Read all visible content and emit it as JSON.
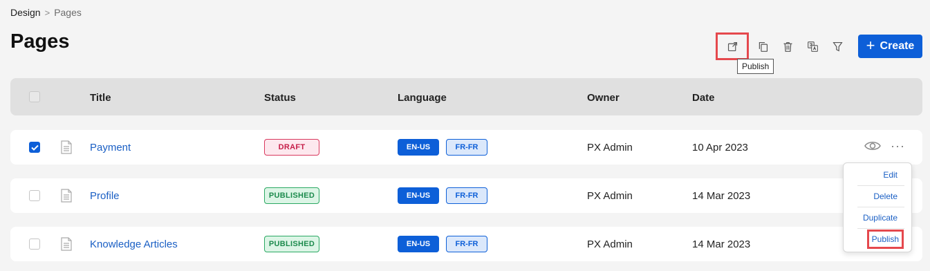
{
  "breadcrumb": {
    "home": "Design",
    "separator": ">",
    "current": "Pages"
  },
  "page_title": "Pages",
  "toolbar": {
    "publish_icon": "external-link-icon",
    "duplicate_icon": "copy-icon",
    "delete_icon": "trash-icon",
    "translate_icon": "translate-icon",
    "filter_icon": "filter-icon",
    "tooltip": "Publish",
    "create_label": "Create",
    "create_icon": "+"
  },
  "table": {
    "columns": {
      "title": "Title",
      "status": "Status",
      "language": "Language",
      "owner": "Owner",
      "date": "Date"
    },
    "rows": [
      {
        "checked": true,
        "title": "Payment",
        "status": "DRAFT",
        "lang_primary": "EN-US",
        "lang_secondary": "FR-FR",
        "owner": "PX Admin",
        "date": "10 Apr 2023"
      },
      {
        "checked": false,
        "title": "Profile",
        "status": "PUBLISHED",
        "lang_primary": "EN-US",
        "lang_secondary": "FR-FR",
        "owner": "PX Admin",
        "date": "14 Mar 2023"
      },
      {
        "checked": false,
        "title": "Knowledge Articles",
        "status": "PUBLISHED",
        "lang_primary": "EN-US",
        "lang_secondary": "FR-FR",
        "owner": "PX Admin",
        "date": "14 Mar 2023"
      }
    ]
  },
  "row_menu": {
    "edit": "Edit",
    "delete": "Delete",
    "duplicate": "Duplicate",
    "publish": "Publish"
  },
  "colors": {
    "accent": "#0d5fd8",
    "highlight": "#e5484d",
    "draft": "#c61f49",
    "published": "#1b8a4c"
  }
}
